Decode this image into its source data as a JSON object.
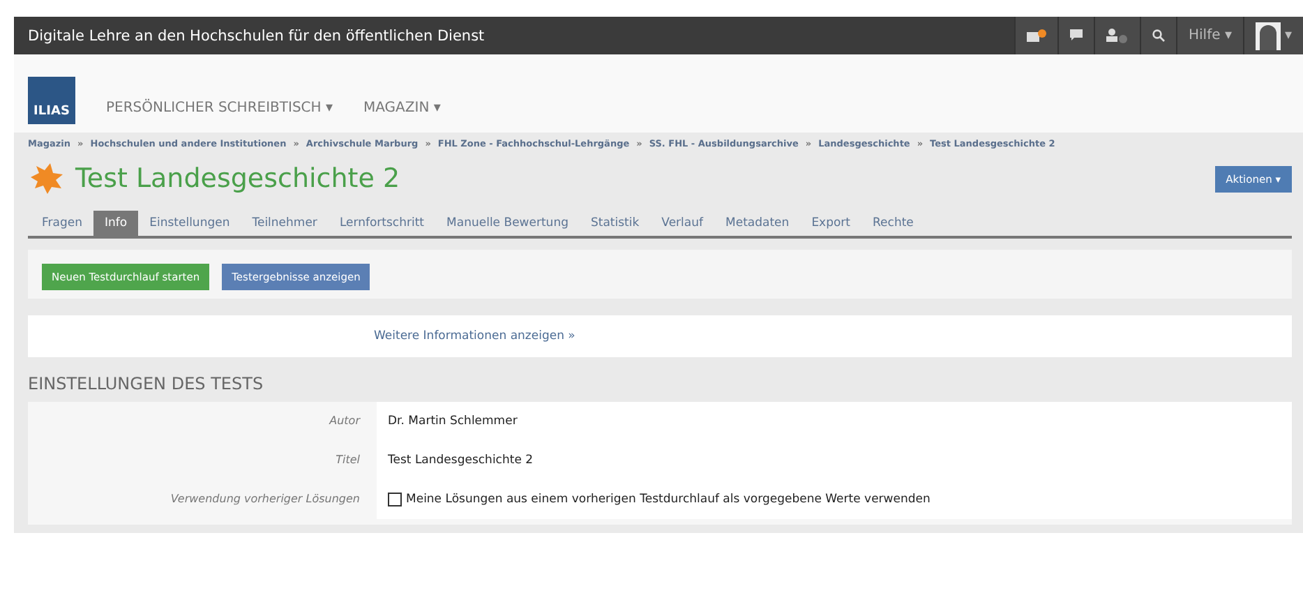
{
  "topbar": {
    "title": "Digitale Lehre an den Hochschulen für den öffentlichen Dienst",
    "help": "Hilfe",
    "caret": "▾"
  },
  "header": {
    "logo": "ILIAS",
    "menu": [
      "PERSÖNLICHER SCHREIBTISCH",
      "MAGAZIN"
    ]
  },
  "breadcrumb": {
    "separator": "»",
    "items": [
      "Magazin",
      "Hochschulen und andere Institutionen",
      "Archivschule Marburg",
      "FHL Zone - Fachhochschul-Lehrgänge",
      "SS. FHL - Ausbildungsarchive",
      "Landesgeschichte",
      "Test Landesgeschichte 2"
    ]
  },
  "page": {
    "title": "Test Landesgeschichte 2",
    "actions": "Aktionen"
  },
  "tabs": [
    {
      "label": "Fragen",
      "selected": false
    },
    {
      "label": "Info",
      "selected": true
    },
    {
      "label": "Einstellungen",
      "selected": false
    },
    {
      "label": "Teilnehmer",
      "selected": false
    },
    {
      "label": "Lernfortschritt",
      "selected": false
    },
    {
      "label": "Manuelle Bewertung",
      "selected": false
    },
    {
      "label": "Statistik",
      "selected": false
    },
    {
      "label": "Verlauf",
      "selected": false
    },
    {
      "label": "Metadaten",
      "selected": false
    },
    {
      "label": "Export",
      "selected": false
    },
    {
      "label": "Rechte",
      "selected": false
    }
  ],
  "buttons": [
    {
      "label": "Neuen Testdurchlauf starten",
      "kind": "primary"
    },
    {
      "label": "Testergebnisse anzeigen",
      "kind": "secondary"
    }
  ],
  "more_info": "Weitere Informationen anzeigen »",
  "section": {
    "title": "EINSTELLUNGEN DES TESTS",
    "rows": [
      {
        "label": "Autor",
        "value": "Dr. Martin Schlemmer",
        "kind": "text"
      },
      {
        "label": "Titel",
        "value": "Test Landesgeschichte 2",
        "kind": "text"
      },
      {
        "label": "Verwendung vorheriger Lösungen",
        "value": "Meine Lösungen aus einem vorherigen Testdurchlauf als vorgegebene Werte verwenden",
        "kind": "checkbox",
        "checked": false
      }
    ]
  }
}
